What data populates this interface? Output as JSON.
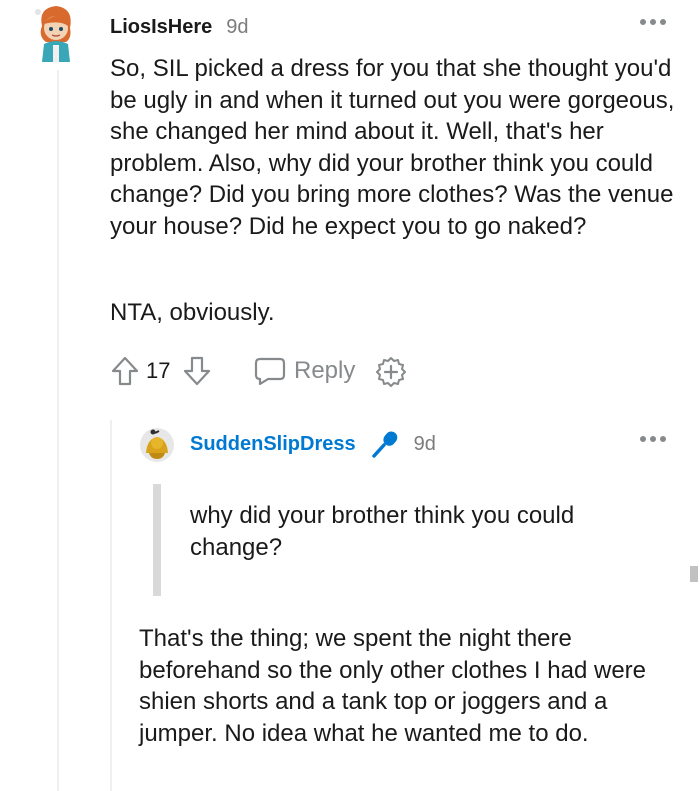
{
  "comment": {
    "username": "LiosIsHere",
    "time": "9d",
    "paragraphs": [
      "So, SIL picked a dress for you that she thought you'd be ugly in and when it turned out you were gorgeous, she changed her mind about it. Well, that's her problem. Also, why did your brother think you could change? Did you bring more clothes? Was the venue your house? Did he expect you to go naked?",
      "NTA, obviously."
    ],
    "votes": "17",
    "reply_label": "Reply"
  },
  "reply": {
    "username": "SuddenSlipDress",
    "time": "9d",
    "quote": "why did your brother think you could change?",
    "text": "That's the thing; we spent the night there beforehand so the only other clothes I had were shien shorts and a tank top or joggers and a jumper. No idea what he wanted me to do."
  },
  "icons": {
    "more": "more-dots-icon",
    "upvote": "arrow-up-icon",
    "downvote": "arrow-down-icon",
    "reply": "speech-bubble-icon",
    "award": "award-plus-icon",
    "op": "microphone-icon"
  },
  "colors": {
    "op_username": "#0079d3",
    "muted": "#7c7c7c",
    "icon_gray": "#878a8c"
  }
}
